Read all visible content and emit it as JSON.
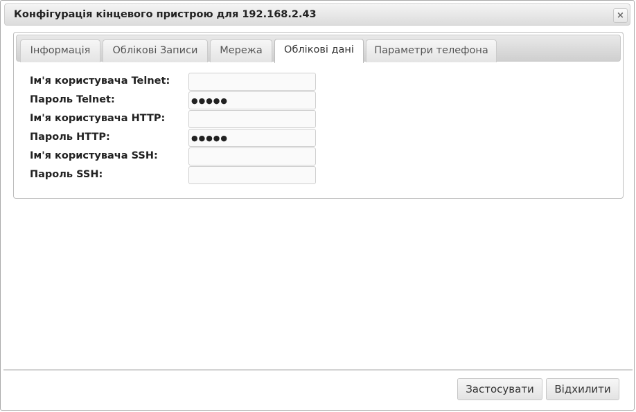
{
  "dialog": {
    "title": "Конфігурація кінцевого пристрою для 192.168.2.43",
    "close_glyph": "×"
  },
  "tabs": [
    {
      "label": "Інформація",
      "active": false
    },
    {
      "label": "Облікові Записи",
      "active": false
    },
    {
      "label": "Мережа",
      "active": false
    },
    {
      "label": "Облікові дані",
      "active": true
    },
    {
      "label": "Параметри телефона",
      "active": false
    }
  ],
  "form": {
    "fields": [
      {
        "label": "Ім'я користувача Telnet:",
        "value": ""
      },
      {
        "label": "Пароль Telnet:",
        "value": "●●●●●"
      },
      {
        "label": "Ім'я користувача HTTP:",
        "value": ""
      },
      {
        "label": "Пароль HTTP:",
        "value": "●●●●●"
      },
      {
        "label": "Ім'я користувача SSH:",
        "value": ""
      },
      {
        "label": "Пароль SSH:",
        "value": ""
      }
    ]
  },
  "footer": {
    "apply_label": "Застосувати",
    "reject_label": "Відхилити"
  }
}
